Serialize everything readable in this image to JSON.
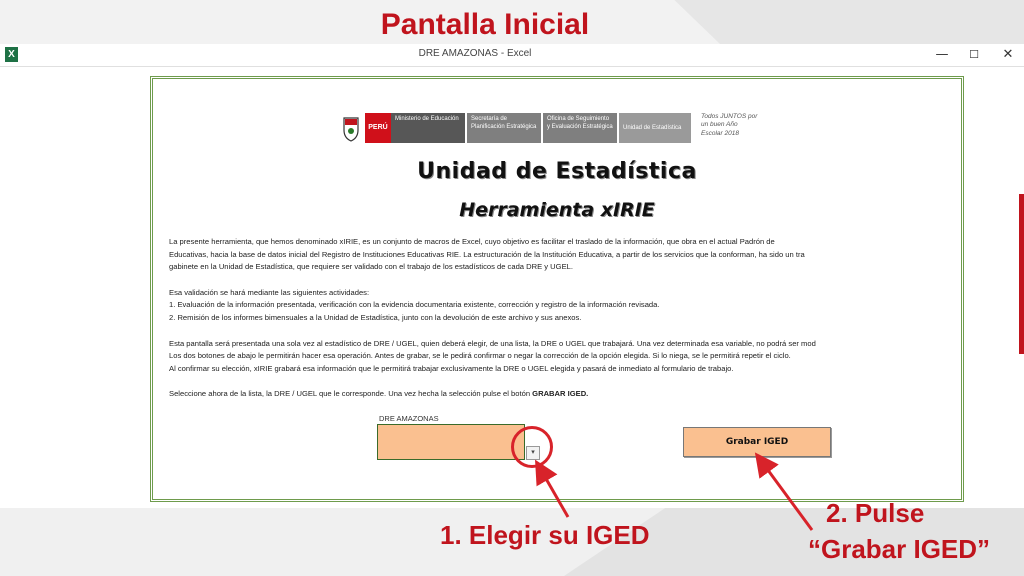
{
  "slide": {
    "title": "Pantalla Inicial",
    "annotation_1": "1. Elegir su IGED",
    "annotation_2_line1": "2. Pulse",
    "annotation_2_line2": "“Grabar IGED”"
  },
  "window": {
    "title": "DRE AMAZONAS - Excel",
    "app_icon": "X",
    "minimize": "—",
    "maximize": "☐",
    "close": "✕"
  },
  "logos": {
    "peru": "PERÚ",
    "minedu": "Ministerio de Educación",
    "spe": "Secretaría de Planificación Estratégica",
    "oser": "Oficina de Seguimiento y Evaluación Estratégica",
    "ue": "Unidad de Estadística",
    "slogan": "Todos JUNTOS por un buen Año Escolar 2018"
  },
  "sheet": {
    "heading": "Unidad de Estadística",
    "subheading": "Herramienta xIRIE",
    "para1_line1": "La presente herramienta, que hemos denominado xIRIE, es un conjunto de macros de Excel, cuyo objetivo es facilitar el traslado de la información, que obra en el actual Padrón de",
    "para1_line2": "Educativas, hacia la base de datos inicial del Registro de Instituciones Educativas RIE. La estructuración de la Institución Educativa, a partir de los servicios que la conforman, ha sido un tra",
    "para1_line3": "gabinete en la Unidad de Estadística, que requiere ser validado con el trabajo de los estadísticos de cada DRE y UGEL.",
    "para2_line1": "Esa validación se hará mediante las siguientes actividades:",
    "para2_line2": "1. Evaluación de la información presentada, verificación con la evidencia documentaria existente, corrección y registro de la información revisada.",
    "para2_line3": "2. Remisión de los informes bimensuales a la Unidad de Estadística, junto con la devolución de este archivo y sus anexos.",
    "para3_line1": "Esta pantalla será presentada una sola vez al estadístico de DRE / UGEL, quien deberá elegir, de una lista, la DRE o UGEL que trabajará. Una vez determinada esa variable, no podrá ser mod",
    "para3_line2": "Los dos botones de abajo le permitirán hacer esa operación.  Antes de grabar, se le pedirá confirmar o negar la corrección de la opción elegida. Si lo niega, se le permitirá repetir el ciclo.",
    "para3_line3": "Al confirmar su elección, xIRIE grabará esa información que le permitirá trabajar exclusivamente la DRE o UGEL elegida y pasará de inmediato al formulario de trabajo.",
    "para4_text": "Seleccione ahora de la lista, la DRE / UGEL que le corresponde. Una vez hecha la selección pulse el botón ",
    "para4_bold": "GRABAR IGED.",
    "dre_label": "DRE AMAZONAS",
    "dropdown_arrow": "▾",
    "grabar_button": "Grabar IGED"
  },
  "colors": {
    "accent_red": "#c0141d",
    "select_fill": "#fac090",
    "panel_border": "#6e9b4c"
  }
}
